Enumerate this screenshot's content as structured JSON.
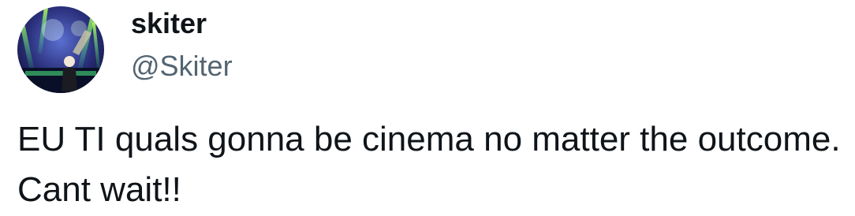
{
  "author": {
    "display_name": "skiter",
    "handle": "@Skiter"
  },
  "tweet": {
    "text": "EU TI quals gonna be cinema no matter the outcome. Cant wait!!"
  },
  "colors": {
    "text_primary": "#0f1419",
    "text_secondary": "#536471",
    "background": "#ffffff"
  },
  "icons": {
    "avatar": "profile-photo"
  }
}
